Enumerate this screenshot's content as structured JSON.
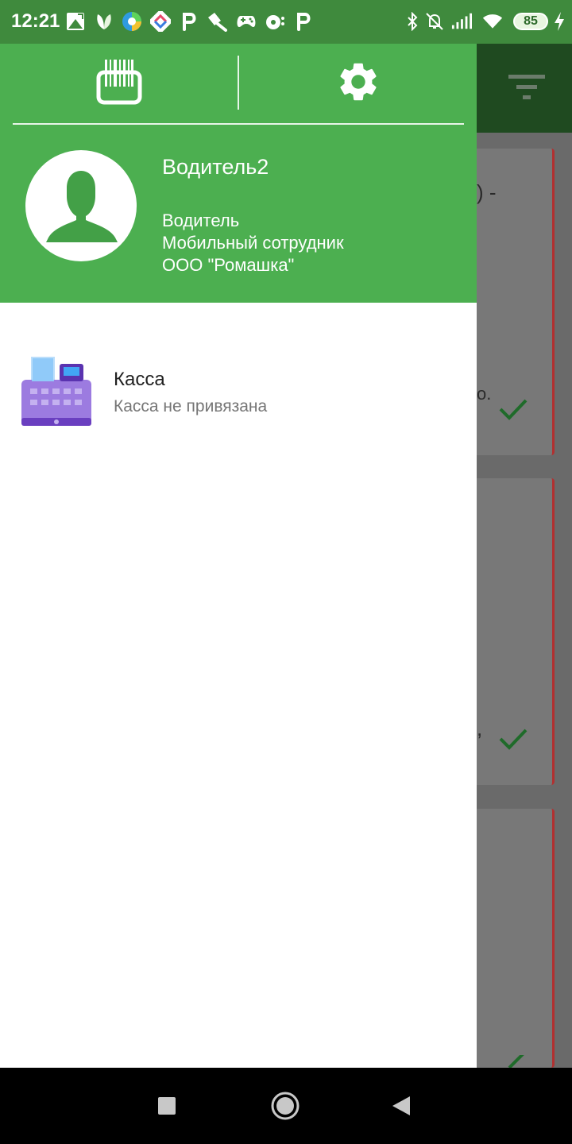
{
  "status_bar": {
    "time": "12:21",
    "battery_level": "85",
    "notification_icons": [
      "gallery-icon",
      "leaf-icon",
      "edge-browser-icon",
      "maps-icon",
      "p-app-icon",
      "brush-icon",
      "gamepad-icon",
      "media-icon",
      "p-app-icon"
    ],
    "system_icons": [
      "bluetooth-icon",
      "silent-icon",
      "signal-icon",
      "wifi-icon",
      "charging-icon"
    ]
  },
  "drawer": {
    "header_color": "#4caf50",
    "header_buttons": [
      "barcode-scanner-icon",
      "settings-gear-icon"
    ],
    "user": {
      "name": "Водитель2",
      "role": "Водитель",
      "position": "Мобильный сотрудник",
      "company": "ООО \"Ромашка\""
    },
    "menu_items": [
      {
        "icon": "cash-register-icon",
        "title": "Касса",
        "subtitle": "Касса не привязана"
      }
    ]
  },
  "background": {
    "appbar_color": "#1f4a20",
    "toolbar_icon": "filter-icon",
    "card_accent": "#b23030",
    "text_fragments": [
      ") -",
      "о.",
      ","
    ]
  },
  "nav_bar": {
    "buttons": [
      "recents-square-icon",
      "home-circle-icon",
      "back-triangle-icon"
    ]
  }
}
